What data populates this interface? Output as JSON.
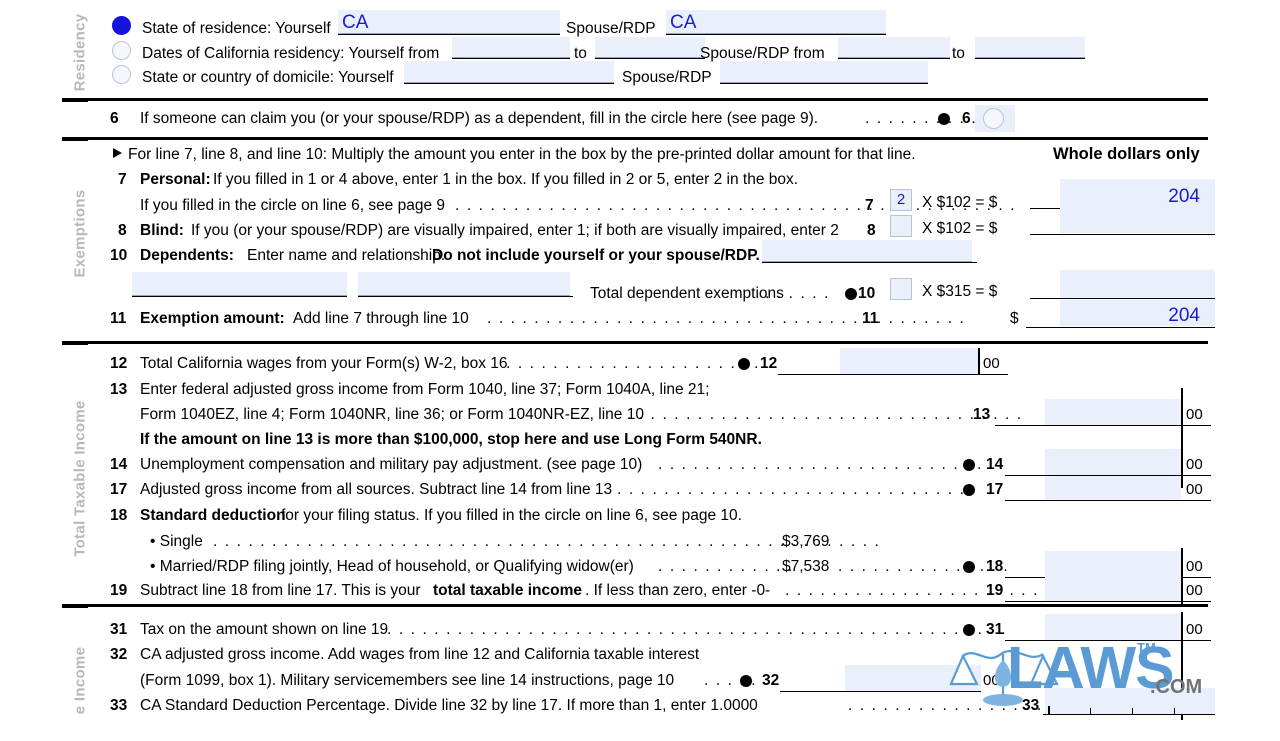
{
  "form": {
    "sections": [
      {
        "label": "Residency"
      },
      {
        "label": "Exemptions"
      },
      {
        "label": "Total Taxable Income"
      },
      {
        "label": "e Income"
      }
    ]
  },
  "residency": {
    "row1": {
      "label": "State of residence: Yourself",
      "value": "CA",
      "spouse_label": "Spouse/RDP",
      "spouse_value": "CA",
      "circle_filled": true
    },
    "row2": {
      "label": "Dates of California residency: Yourself from",
      "to1": "to",
      "spouse_label": "Spouse/RDP from",
      "to2": "to",
      "circle_filled": false
    },
    "row3": {
      "label": "State or country of domicile: Yourself",
      "spouse_label": "Spouse/RDP",
      "circle_filled": false
    }
  },
  "line6": {
    "number": "6",
    "text": "If someone can claim you (or your spouse/RDP) as a dependent, fill in the circle here (see page 9).",
    "dots": ". . . . . . . . . . .",
    "marker_number": "6"
  },
  "exemptions": {
    "instruction": "For line 7, line 8, and line 10: Multiply the amount you enter in the box by the pre-printed dollar amount for that line.",
    "whole_dollars": "Whole dollars only",
    "line7": {
      "number": "7",
      "bold_label": "Personal:",
      "text": "If you filled in 1 or 4 above, enter 1 in the box. If you filled in 2 or 5, enter 2 in the box.",
      "text2": "If you filled in the circle on line 6, see page 9",
      "dots": ". . . . . . . . . . . . . . . . . . . . . . . . . . . . . . . . . . . . . . . . . . . . . . . .",
      "ref": "7",
      "box_value": "2",
      "multiplier": "X  $102  =  $",
      "amount": "204"
    },
    "line8": {
      "number": "8",
      "bold_label": "Blind:",
      "text": "If you (or your spouse/RDP) are visually impaired, enter 1; if both are visually impaired, enter 2",
      "ref": "8",
      "box_value": "",
      "multiplier": "X  $102  =  $",
      "amount": ""
    },
    "line10": {
      "number": "10",
      "bold_label": "Dependents:",
      "text": "Enter name and relationship.",
      "bold_text2": "Do not include yourself or your spouse/RDP.",
      "total_label": "Total dependent exemptions",
      "dots": ". . . . . .",
      "ref": "10",
      "box_value": "",
      "multiplier": "X  $315  =  $",
      "amount": ""
    },
    "line11": {
      "number": "11",
      "bold_label": "Exemption amount:",
      "text": "Add line 7 through line 10",
      "dots": ". . . . . . . . . . . . . . . . . . . . . . . . . . . . . . . . . . . . . . . . .",
      "ref": "11",
      "dollar": "$",
      "amount": "204"
    }
  },
  "taxable_income": {
    "line12": {
      "number": "12",
      "text": "Total California wages from your Form(s) W-2, box 16",
      "dots": ". . . . . . . . . . . . . . . . . . . . . .",
      "ref": "12",
      "amount": "",
      "cents": "00"
    },
    "line13": {
      "number": "13",
      "text": "Enter federal adjusted gross income from Form 1040, line 37; Form 1040A, line 21;",
      "text2": "Form 1040EZ, line 4; Form 1040NR, line 36; or Form 1040NR-EZ, line 10",
      "dots": ". . . . . . . . . . . . . . . . . . . . . . . . . . . . . . . . . .",
      "ref": "13",
      "amount": "",
      "cents": "00",
      "warning": "If the amount on line 13 is more than $100,000, stop here and use Long Form 540NR."
    },
    "line14": {
      "number": "14",
      "text": "Unemployment compensation and military pay adjustment. (see page 10)",
      "dots": ". . . . . . . . . . . . . . . . . . . . . . . . . . . .",
      "ref": "14",
      "amount": "",
      "cents": "00"
    },
    "line17": {
      "number": "17",
      "text": "Adjusted gross income from all sources. Subtract line 14 from line 13",
      "dots": ". . . . . . . . . . . . . . . . . . . . . . . . . . . . . .",
      "ref": "17",
      "amount": "",
      "cents": "00"
    },
    "line18": {
      "number": "18",
      "bold_label": "Standard deduction",
      "text": "for your filing status. If you filled in the circle on line 6, see page 10.",
      "bullet1": "• Single",
      "bullet1_dots": ". . . . . . . . . . . . . . . . . . . . . . . . . . . . . . . . . . . . . . . . . . . . . . . . . . . . . . . . .",
      "bullet1_amount": "$3,769",
      "bullet2": "• Married/RDP filing jointly, Head of household, or Qualifying widow(er)",
      "bullet2_dots": ". . . . . . . . . . . .",
      "bullet2_amount": "$7,538",
      "bullet2_dots2": ". . . . . . . . . . . . . . .",
      "ref": "18",
      "amount": "",
      "cents": "00"
    },
    "line19": {
      "number": "19",
      "text": "Subtract line 18 from line 17. This is your",
      "bold_text": "total taxable income",
      "text2": ". If less than zero, enter -0-",
      "dots": ". . . . . . . . . . . . . . . . . . . . . .",
      "ref": "19",
      "amount": "",
      "cents": "00"
    }
  },
  "tax_income": {
    "line31": {
      "number": "31",
      "text": "Tax on the amount shown on line 19",
      "dots": ". . . . . . . . . . . . . . . . . . . . . . . . . . . . . . . . . . . . . . . . . . . . . . . . . . . . .",
      "ref": "31",
      "amount": "",
      "cents": "00"
    },
    "line32": {
      "number": "32",
      "text": "CA adjusted gross income. Add wages from line 12 and California taxable interest",
      "text2": "(Form 1099, box 1). Military servicemembers see line 14 instructions, page 10",
      "dots": ". . . . .",
      "ref": "32",
      "amount": "",
      "cents": "00"
    },
    "line33": {
      "number": "33",
      "text": "CA Standard Deduction Percentage. Divide line 32 by line 17. If more than 1, enter 1.0000",
      "dots": ". . . . . . . . . . . . . . . . . . . . . . . .",
      "ref": "33",
      "amount": ""
    }
  },
  "watermark": {
    "name": "LAWS",
    "tm": "TM",
    "domain": ".COM",
    "color": "#5b9bd5"
  }
}
